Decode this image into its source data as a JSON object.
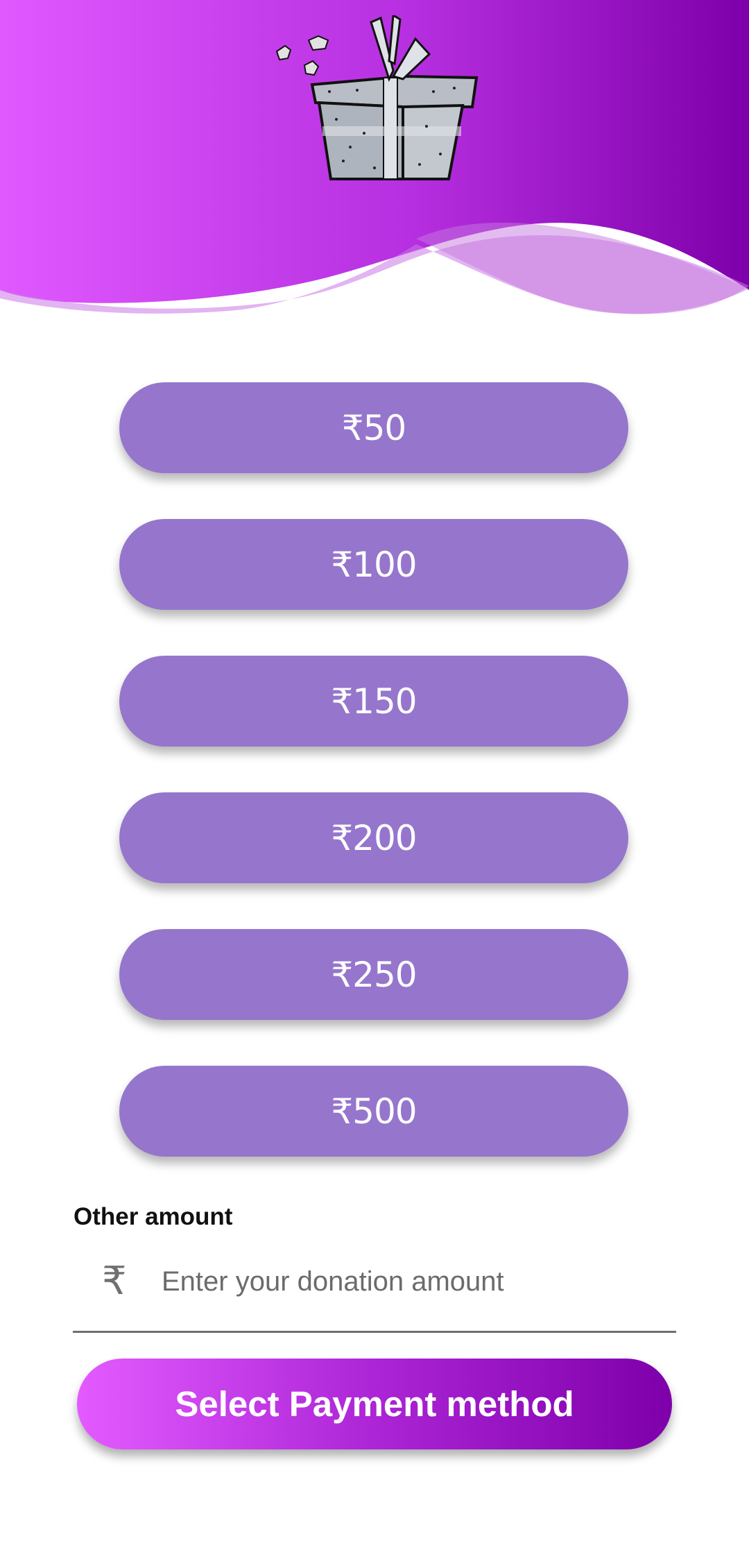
{
  "colors": {
    "header_gradient_start": "#e059ff",
    "header_gradient_end": "#7e00aa",
    "amount_button": "#9576cc",
    "text_on_button": "#ffffff"
  },
  "header": {
    "illustration": "gift-box-icon"
  },
  "amount_options": [
    {
      "label": "₹50"
    },
    {
      "label": "₹100"
    },
    {
      "label": "₹150"
    },
    {
      "label": "₹200"
    },
    {
      "label": "₹250"
    },
    {
      "label": "₹500"
    }
  ],
  "other_amount": {
    "label": "Other amount",
    "currency_symbol": "₹",
    "value": "",
    "placeholder": "Enter your donation amount"
  },
  "payment_button": {
    "label": "Select Payment method"
  }
}
